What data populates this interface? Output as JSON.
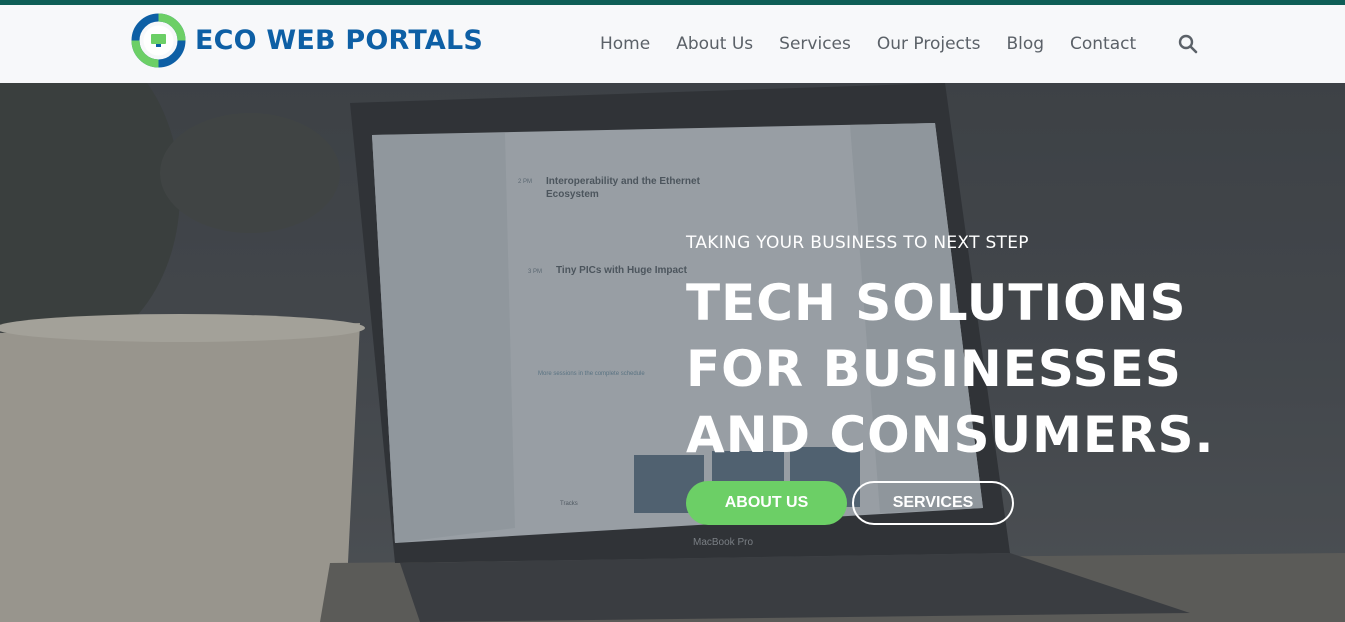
{
  "brand": {
    "name": "ECO WEB PORTALS"
  },
  "nav": {
    "items": [
      {
        "label": "Home"
      },
      {
        "label": "About Us"
      },
      {
        "label": "Services"
      },
      {
        "label": "Our Projects"
      },
      {
        "label": "Blog"
      },
      {
        "label": "Contact"
      }
    ],
    "search_icon": "search-icon"
  },
  "hero": {
    "kicker": "TAKING YOUR BUSINESS TO NEXT STEP",
    "headline_lines": [
      "TECH SOLUTIONS",
      "FOR BUSINESSES",
      "AND CONSUMERS."
    ],
    "primary_button": "ABOUT US",
    "secondary_button": "SERVICES"
  },
  "laptop_screen": {
    "session1_time": "2 PM",
    "session1_title": "Interoperability and the Ethernet Ecosystem",
    "session2_time": "3 PM",
    "session2_title": "Tiny PICs with Huge Impact",
    "schedule_link": "More sessions in the complete schedule",
    "tracks_label": "Tracks",
    "macbook_label": "MacBook Pro"
  },
  "colors": {
    "brand_blue": "#0d5fa5",
    "brand_green": "#6ccf66",
    "top_bar": "#0e5e57"
  }
}
